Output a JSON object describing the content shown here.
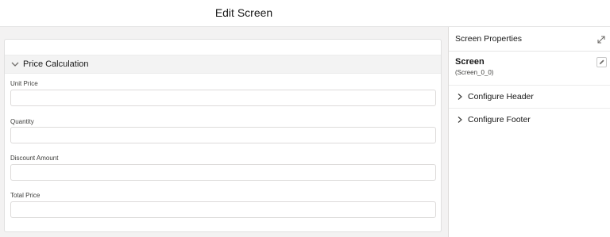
{
  "header": {
    "title": "Edit Screen"
  },
  "canvas": {
    "section": {
      "title": "Price Calculation",
      "fields": [
        {
          "label": "Unit Price",
          "value": ""
        },
        {
          "label": "Quantity",
          "value": ""
        },
        {
          "label": "Discount Amount",
          "value": ""
        },
        {
          "label": "Total Price",
          "value": ""
        }
      ]
    }
  },
  "properties_panel": {
    "title": "Screen Properties",
    "screen_label": "Screen",
    "screen_api_name": "(Screen_0_0)",
    "sections": [
      {
        "label": "Configure Header"
      },
      {
        "label": "Configure Footer"
      }
    ]
  },
  "colors": {
    "canvas_bg": "#f3f2f2",
    "border": "#dddbda",
    "section_header_bg": "#f3f3f3",
    "text": "#181818"
  }
}
